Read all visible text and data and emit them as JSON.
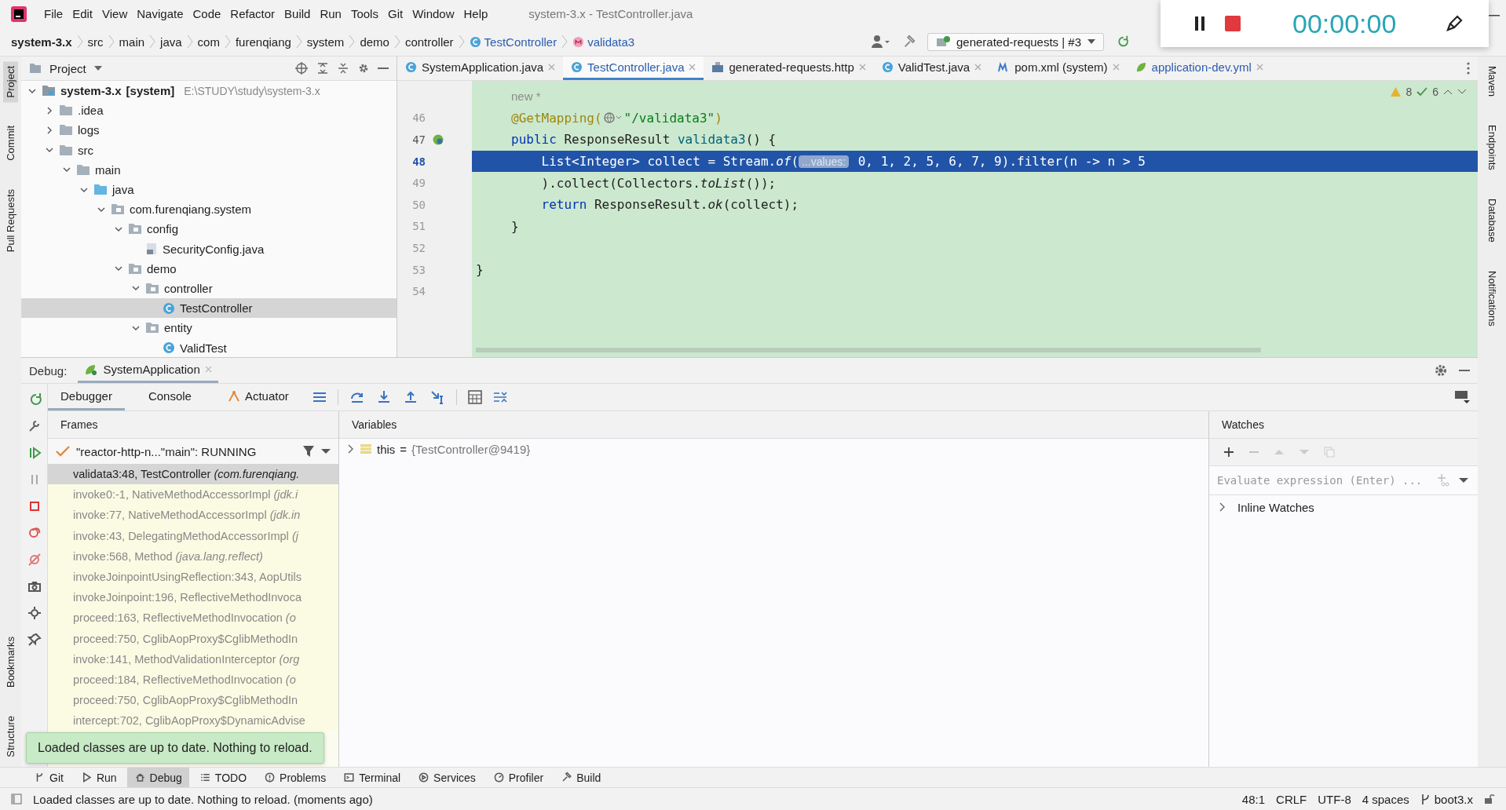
{
  "menu": [
    "File",
    "Edit",
    "View",
    "Navigate",
    "Code",
    "Refactor",
    "Build",
    "Run",
    "Tools",
    "Git",
    "Window",
    "Help"
  ],
  "window": {
    "title": "system-3.x - TestController.java"
  },
  "breadcrumbs": [
    {
      "label": "system-3.x",
      "kind": "project"
    },
    {
      "label": "src",
      "kind": "dir"
    },
    {
      "label": "main",
      "kind": "dir"
    },
    {
      "label": "java",
      "kind": "dir"
    },
    {
      "label": "com",
      "kind": "dir"
    },
    {
      "label": "furenqiang",
      "kind": "dir"
    },
    {
      "label": "system",
      "kind": "dir"
    },
    {
      "label": "demo",
      "kind": "dir"
    },
    {
      "label": "controller",
      "kind": "dir"
    },
    {
      "label": "TestController",
      "kind": "class"
    },
    {
      "label": "validata3",
      "kind": "method"
    }
  ],
  "run_config": {
    "label": "generated-requests | #3"
  },
  "recorder": {
    "time": "00:00:00"
  },
  "side_left": {
    "top": [
      {
        "label": "Project",
        "selected": true
      },
      {
        "label": "Commit",
        "selected": false
      },
      {
        "label": "Pull Requests",
        "selected": false
      }
    ],
    "bottom": [
      {
        "label": "Bookmarks",
        "selected": false
      },
      {
        "label": "Structure",
        "selected": false
      }
    ]
  },
  "side_right": [
    {
      "label": "Maven"
    },
    {
      "label": "Endpoints"
    },
    {
      "label": "Database"
    },
    {
      "label": "Notifications"
    }
  ],
  "project": {
    "title": "Project",
    "tree": [
      {
        "label": "system-3.x",
        "tag": "[system]",
        "path": "E:\\STUDY\\study\\system-3.x",
        "kind": "module",
        "expanded": true,
        "selected": false,
        "children": [
          {
            "label": ".idea",
            "kind": "folder",
            "expanded": false,
            "selected": false
          },
          {
            "label": "logs",
            "kind": "folder",
            "expanded": false,
            "selected": false
          },
          {
            "label": "src",
            "kind": "folder",
            "expanded": true,
            "selected": false,
            "children": [
              {
                "label": "main",
                "kind": "folder",
                "expanded": true,
                "selected": false,
                "children": [
                  {
                    "label": "java",
                    "kind": "source",
                    "expanded": true,
                    "selected": false,
                    "children": [
                      {
                        "label": "com.furenqiang.system",
                        "kind": "package",
                        "expanded": true,
                        "selected": false,
                        "children": [
                          {
                            "label": "config",
                            "kind": "package",
                            "expanded": true,
                            "selected": false,
                            "children": [
                              {
                                "label": "SecurityConfig.java",
                                "kind": "file",
                                "selected": false
                              }
                            ]
                          },
                          {
                            "label": "demo",
                            "kind": "package",
                            "expanded": true,
                            "selected": false,
                            "children": [
                              {
                                "label": "controller",
                                "kind": "package",
                                "expanded": true,
                                "selected": false,
                                "children": [
                                  {
                                    "label": "TestController",
                                    "kind": "class",
                                    "selected": true
                                  }
                                ]
                              },
                              {
                                "label": "entity",
                                "kind": "package",
                                "expanded": true,
                                "selected": false,
                                "children": [
                                  {
                                    "label": "ValidTest",
                                    "kind": "class",
                                    "selected": false
                                  }
                                ]
                              }
                            ]
                          }
                        ]
                      }
                    ]
                  }
                ]
              }
            ]
          }
        ]
      }
    ]
  },
  "editor_tabs": [
    {
      "label": "SystemApplication.java",
      "kind": "class",
      "selected": false,
      "modified": false
    },
    {
      "label": "TestController.java",
      "kind": "class",
      "selected": true,
      "modified": false
    },
    {
      "label": "generated-requests.http",
      "kind": "http",
      "selected": false,
      "modified": false
    },
    {
      "label": "ValidTest.java",
      "kind": "class",
      "selected": false,
      "modified": false
    },
    {
      "label": "pom.xml (system)",
      "kind": "maven",
      "selected": false,
      "modified": false
    },
    {
      "label": "application-dev.yml",
      "kind": "yaml",
      "selected": false,
      "modified": true
    }
  ],
  "inspections": {
    "warnings": "8",
    "weak": "6"
  },
  "code": [
    {
      "highlighted": false,
      "gutter_icon": false,
      "segments": [
        {
          "kind": "hint",
          "text": "new *"
        }
      ]
    },
    {
      "number": "46",
      "highlighted": false,
      "gutter_icon": false,
      "segments": [
        {
          "kind": "annotation",
          "text": "@GetMapping("
        },
        {
          "kind": "globe"
        },
        {
          "kind": "string",
          "text": "\"/validata3\""
        },
        {
          "kind": "annotation",
          "text": ")"
        }
      ]
    },
    {
      "number": "47",
      "highlighted": false,
      "gutter_icon": true,
      "segments": [
        {
          "kind": "keyword",
          "text": "public"
        },
        {
          "kind": "plain",
          "text": " ResponseResult "
        },
        {
          "kind": "method",
          "text": "validata3"
        },
        {
          "kind": "plain",
          "text": "() {"
        }
      ]
    },
    {
      "number": "48",
      "highlighted": true,
      "gutter_icon": false,
      "segments": [
        {
          "kind": "plain",
          "text": "    List<Integer> collect = Stream."
        },
        {
          "kind": "italic",
          "text": "of"
        },
        {
          "kind": "plain",
          "text": "("
        },
        {
          "kind": "param",
          "text": "...values:"
        },
        {
          "kind": "plain",
          "text": " 0, 1, 2, 5, 6, 7, 9).filter(n -> n > 5"
        }
      ]
    },
    {
      "number": "49",
      "highlighted": false,
      "gutter_icon": false,
      "segments": [
        {
          "kind": "plain",
          "text": "    ).collect(Collectors."
        },
        {
          "kind": "italic",
          "text": "toList"
        },
        {
          "kind": "plain",
          "text": "());"
        }
      ]
    },
    {
      "number": "50",
      "highlighted": false,
      "gutter_icon": false,
      "segments": [
        {
          "kind": "keyword",
          "text": "    return"
        },
        {
          "kind": "plain",
          "text": " ResponseResult."
        },
        {
          "kind": "italic",
          "text": "ok"
        },
        {
          "kind": "plain",
          "text": "(collect);"
        }
      ]
    },
    {
      "number": "51",
      "highlighted": false,
      "gutter_icon": false,
      "segments": [
        {
          "kind": "plain",
          "text": "}"
        }
      ]
    },
    {
      "number": "52",
      "highlighted": false,
      "gutter_icon": false
    },
    {
      "number": "53",
      "highlighted": false,
      "gutter_icon": false,
      "segments": [
        {
          "kind": "outer",
          "text": "}"
        }
      ]
    },
    {
      "number": "54",
      "highlighted": false,
      "gutter_icon": false
    }
  ],
  "debug": {
    "label": "Debug:",
    "session": "SystemApplication",
    "tabs": [
      {
        "label": "Debugger",
        "selected": true,
        "kind": "plain"
      },
      {
        "label": "Console",
        "selected": false,
        "kind": "plain"
      },
      {
        "label": "Actuator",
        "selected": false,
        "kind": "actuator"
      }
    ],
    "frames_title": "Frames",
    "thread": "\"reactor-http-n...\"main\": RUNNING",
    "frames": [
      {
        "text": "validata3:48, TestController *(com.furenqiang.*",
        "library": false,
        "selected": true
      },
      {
        "text": "invoke0:-1, NativeMethodAccessorImpl *(jdk.i*",
        "library": true,
        "selected": false
      },
      {
        "text": "invoke:77, NativeMethodAccessorImpl *(jdk.in*",
        "library": true,
        "selected": false
      },
      {
        "text": "invoke:43, DelegatingMethodAccessorImpl *(j*",
        "library": true,
        "selected": false
      },
      {
        "text": "invoke:568, Method *(java.lang.reflect)*",
        "library": true,
        "selected": false
      },
      {
        "text": "invokeJoinpointUsingReflection:343, AopUtils",
        "library": true,
        "selected": false
      },
      {
        "text": "invokeJoinpoint:196, ReflectiveMethodInvoca",
        "library": true,
        "selected": false
      },
      {
        "text": "proceed:163, ReflectiveMethodInvocation *(o*",
        "library": true,
        "selected": false
      },
      {
        "text": "proceed:750, CglibAopProxy$CglibMethodIn",
        "library": true,
        "selected": false
      },
      {
        "text": "invoke:141, MethodValidationInterceptor *(org*",
        "library": true,
        "selected": false
      },
      {
        "text": "proceed:184, ReflectiveMethodInvocation *(o*",
        "library": true,
        "selected": false
      },
      {
        "text": "proceed:750, CglibAopProxy$CglibMethodIn",
        "library": true,
        "selected": false
      },
      {
        "text": "intercept:702, CglibAopProxy$DynamicAdvise",
        "library": true,
        "selected": false
      }
    ],
    "variables_title": "Variables",
    "variables": [
      {
        "name": "this",
        "operator": "=",
        "value": "{TestController@9419}"
      }
    ],
    "watches_title": "Watches",
    "evaluate": {
      "placeholder": "Evaluate expression (Enter) ..."
    },
    "inline_watches": "Inline Watches"
  },
  "toast": "Loaded classes are up to date. Nothing to reload.",
  "tool_windows": [
    {
      "label": "Git",
      "kind": "git",
      "selected": false
    },
    {
      "label": "Run",
      "kind": "run",
      "selected": false
    },
    {
      "label": "Debug",
      "kind": "debug",
      "selected": true
    },
    {
      "label": "TODO",
      "kind": "todo",
      "selected": false
    },
    {
      "label": "Problems",
      "kind": "problems",
      "selected": false
    },
    {
      "label": "Terminal",
      "kind": "terminal",
      "selected": false
    },
    {
      "label": "Services",
      "kind": "services",
      "selected": false
    },
    {
      "label": "Profiler",
      "kind": "profiler",
      "selected": false
    },
    {
      "label": "Build",
      "kind": "build",
      "selected": false
    }
  ],
  "status_bar": {
    "message": "Loaded classes are up to date. Nothing to reload. (moments ago)",
    "items": [
      {
        "text": "48:1",
        "kind": "plain"
      },
      {
        "text": "CRLF",
        "kind": "plain"
      },
      {
        "text": "UTF-8",
        "kind": "plain"
      },
      {
        "text": "4 spaces",
        "kind": "plain"
      },
      {
        "text": "boot3.x",
        "kind": "branch"
      }
    ]
  }
}
